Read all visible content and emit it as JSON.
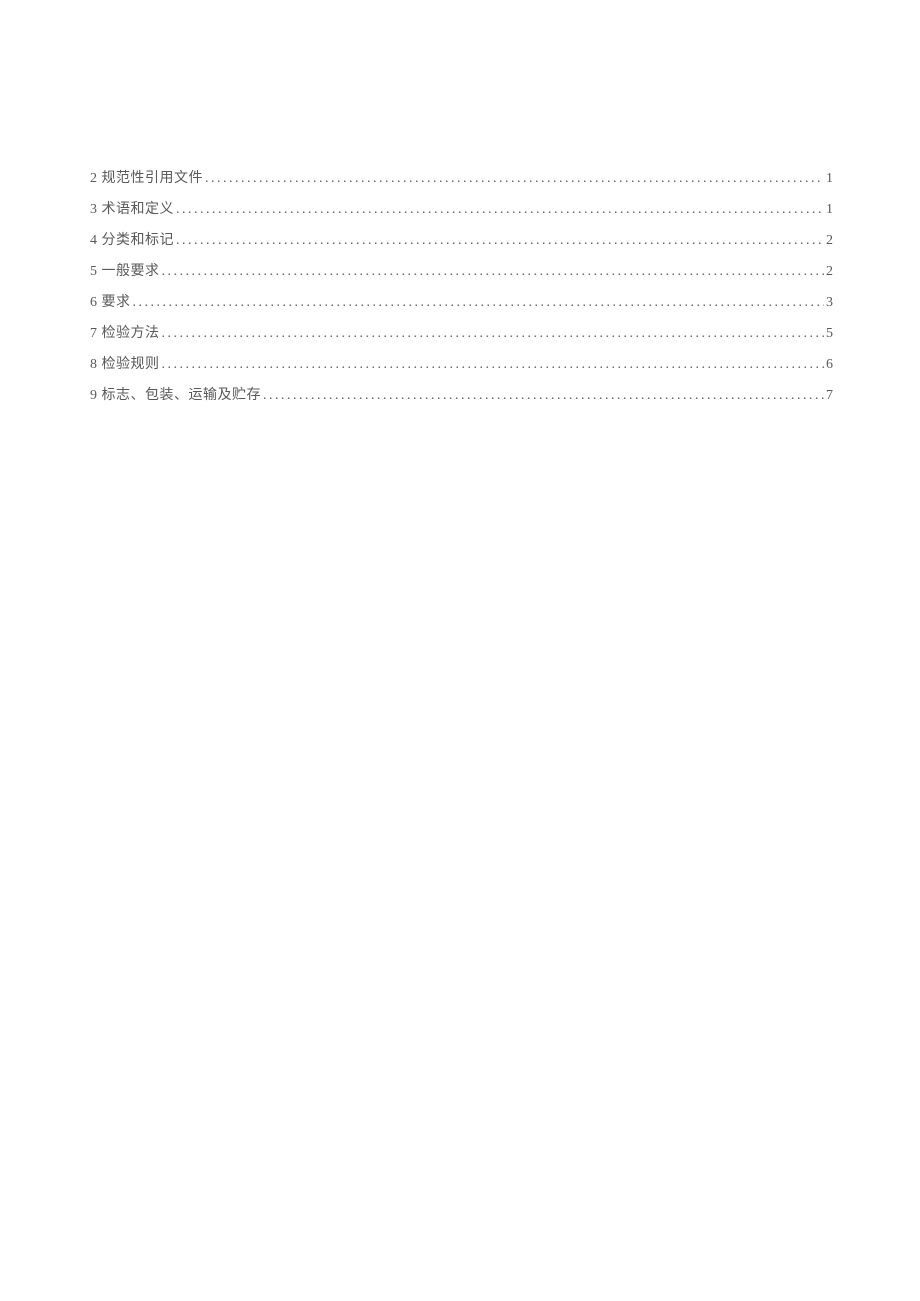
{
  "toc": [
    {
      "label": "2 规范性引用文件",
      "page": "1"
    },
    {
      "label": "3 术语和定义",
      "page": "1"
    },
    {
      "label": "4 分类和标记",
      "page": "2"
    },
    {
      "label": "5 一般要求",
      "page": "2"
    },
    {
      "label": "6 要求",
      "page": "3"
    },
    {
      "label": "7 检验方法",
      "page": "5"
    },
    {
      "label": "8 检验规则",
      "page": "6"
    },
    {
      "label": "9 标志、包装、运输及贮存",
      "page": "7"
    }
  ]
}
